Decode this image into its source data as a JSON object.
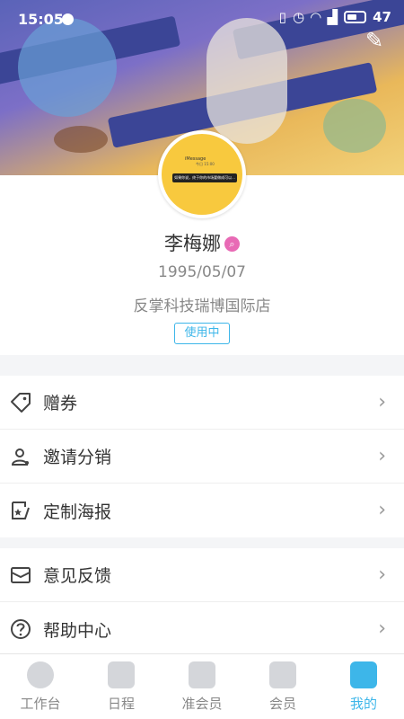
{
  "status_bar": {
    "time": "15:05",
    "battery": "47"
  },
  "profile": {
    "name": "李梅娜",
    "birthday": "1995/05/07",
    "company": "反掌科技瑞博国际店",
    "status_tag": "使用中",
    "avatar_text": {
      "title": "iMessage",
      "subtitle": "今日 15:00",
      "bubble": "如果你说，终于你的市场要做成可以..."
    }
  },
  "menu": {
    "group1": [
      {
        "label": "赠券",
        "icon": "tag-icon"
      },
      {
        "label": "邀请分销",
        "icon": "share-user-icon"
      },
      {
        "label": "定制海报",
        "icon": "poster-icon"
      }
    ],
    "group2": [
      {
        "label": "意见反馈",
        "icon": "mail-icon"
      },
      {
        "label": "帮助中心",
        "icon": "help-icon"
      }
    ]
  },
  "tabbar": [
    {
      "label": "工作台",
      "icon": "pie-chart-icon",
      "active": false
    },
    {
      "label": "日程",
      "icon": "calendar-icon",
      "active": false
    },
    {
      "label": "准会员",
      "icon": "prospect-users-icon",
      "active": false
    },
    {
      "label": "会员",
      "icon": "vip-member-icon",
      "active": false
    },
    {
      "label": "我的",
      "icon": "profile-icon",
      "active": true
    }
  ],
  "colors": {
    "accent": "#3db6e9",
    "badge": "#e86ab5",
    "avatar_bg": "#f8c93e"
  }
}
